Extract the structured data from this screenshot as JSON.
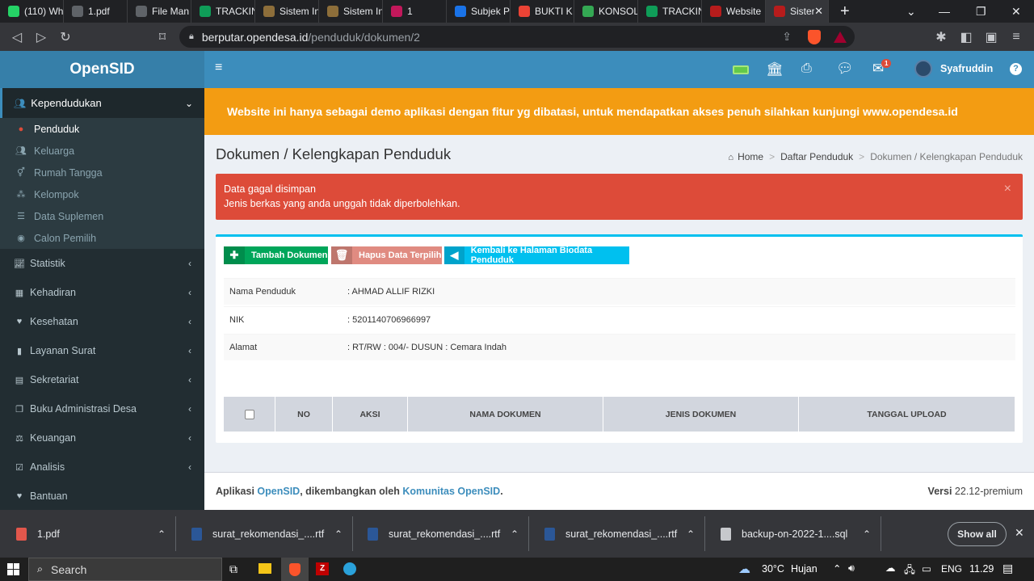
{
  "browser": {
    "tabs": [
      {
        "title": "(110) Wh",
        "icon": "whatsapp-icon",
        "color": "#25d366"
      },
      {
        "title": "1.pdf",
        "icon": "globe-icon",
        "color": "#5f6368"
      },
      {
        "title": "File Man",
        "icon": "globe-icon",
        "color": "#5f6368"
      },
      {
        "title": "TRACKIN",
        "icon": "sheets-icon",
        "color": "#0f9d58"
      },
      {
        "title": "Sistem In",
        "icon": "emblem-icon",
        "color": "#8d6e3a"
      },
      {
        "title": "Sistem In",
        "icon": "emblem-icon",
        "color": "#8d6e3a"
      },
      {
        "title": "1",
        "icon": "settings-icon",
        "color": "#c2185b"
      },
      {
        "title": "Subjek P",
        "icon": "mail-icon",
        "color": "#1a73e8"
      },
      {
        "title": "BUKTI K",
        "icon": "gmail-icon",
        "color": "#ea4335"
      },
      {
        "title": "KONSOL",
        "icon": "star-icon",
        "color": "#34a853"
      },
      {
        "title": "TRACKIN",
        "icon": "sheets-icon",
        "color": "#0f9d58"
      },
      {
        "title": "Website",
        "icon": "shield-icon",
        "color": "#b71c1c"
      },
      {
        "title": "Sister",
        "icon": "shield-icon",
        "color": "#b71c1c"
      }
    ],
    "new_tab": "+",
    "url_host": "berputar.opendesa.id",
    "url_path": "/penduduk/dokumen/2"
  },
  "sidebar": {
    "brand": "OpenSID",
    "section": "Kependudukan",
    "sub_items": [
      {
        "label": "Penduduk",
        "icon": "user-icon"
      },
      {
        "label": "Keluarga",
        "icon": "users-icon"
      },
      {
        "label": "Rumah Tangga",
        "icon": "venus-mars-icon"
      },
      {
        "label": "Kelompok",
        "icon": "sitemap-icon"
      },
      {
        "label": "Data Suplemen",
        "icon": "database-icon"
      },
      {
        "label": "Calon Pemilih",
        "icon": "podcast-icon"
      }
    ],
    "items": [
      {
        "label": "Statistik",
        "icon": "chart-icon"
      },
      {
        "label": "Kehadiran",
        "icon": "calendar-icon"
      },
      {
        "label": "Kesehatan",
        "icon": "heartbeat-icon"
      },
      {
        "label": "Layanan Surat",
        "icon": "book-icon"
      },
      {
        "label": "Sekretariat",
        "icon": "archive-icon"
      },
      {
        "label": "Buku Administrasi Desa",
        "icon": "copy-icon"
      },
      {
        "label": "Keuangan",
        "icon": "balance-icon"
      },
      {
        "label": "Analisis",
        "icon": "check-square-icon"
      },
      {
        "label": "Bantuan",
        "icon": "heart-icon"
      }
    ]
  },
  "header": {
    "user": "Syafruddin",
    "mail_badge": "1"
  },
  "banner": "Website ini hanya sebagai demo aplikasi dengan fitur yg dibatasi, untuk mendapatkan akses penuh silahkan kunjungi www.opendesa.id",
  "page": {
    "title": "Dokumen / Kelengkapan Penduduk",
    "breadcrumb": [
      "Home",
      "Daftar Penduduk",
      "Dokumen / Kelengkapan Penduduk"
    ]
  },
  "alert": {
    "line1": "Data gagal disimpan",
    "line2": "Jenis berkas yang anda unggah tidak diperbolehkan.",
    "close": "×"
  },
  "buttons": {
    "add": "Tambah Dokumen",
    "delete": "Hapus Data Terpilih",
    "back": "Kembali ke Halaman Biodata Penduduk"
  },
  "info": [
    {
      "label": "Nama Penduduk",
      "value": ": AHMAD ALLIF RIZKI"
    },
    {
      "label": "NIK",
      "value": ": 5201140706966997"
    },
    {
      "label": "Alamat",
      "value": ": RT/RW : 004/- DUSUN : Cemara Indah"
    }
  ],
  "table": {
    "columns": [
      "NO",
      "AKSI",
      "NAMA DOKUMEN",
      "JENIS DOKUMEN",
      "TANGGAL UPLOAD"
    ]
  },
  "footer": {
    "prefix": "Aplikasi",
    "app": "OpenSID",
    "middle": ", dikembangkan oleh",
    "org": "Komunitas OpenSID",
    "suffix": ".",
    "version_label": "Versi",
    "version": "22.12-premium"
  },
  "downloads": {
    "items": [
      {
        "name": "1.pdf",
        "icon": "pdf-icon"
      },
      {
        "name": "surat_rekomendasi_....rtf",
        "icon": "word-icon"
      },
      {
        "name": "surat_rekomendasi_....rtf",
        "icon": "word-icon"
      },
      {
        "name": "surat_rekomendasi_....rtf",
        "icon": "word-icon"
      },
      {
        "name": "backup-on-2022-1....sql",
        "icon": "file-icon"
      }
    ],
    "show_all": "Show all"
  },
  "taskbar": {
    "search": "Search",
    "weather": "30°C",
    "weather_desc": "Hujan",
    "lang": "ENG",
    "time": "11.29"
  },
  "colors": {
    "primary": "#3c8dbc",
    "warning": "#f39c12",
    "danger": "#dd4b39",
    "success": "#00a65a",
    "info": "#00c0ef",
    "sidebar": "#222d32"
  }
}
